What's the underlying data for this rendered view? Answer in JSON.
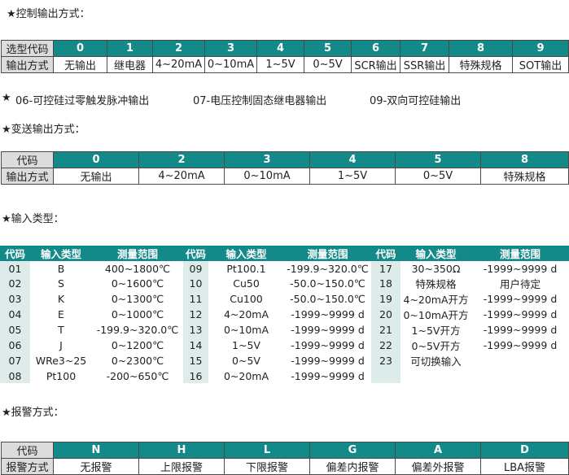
{
  "control_output": {
    "heading": "★控制输出方式：",
    "row1_label": "选型代码",
    "row2_label": "输出方式",
    "codes": [
      "0",
      "1",
      "2",
      "3",
      "4",
      "5",
      "6",
      "7",
      "8",
      "9"
    ],
    "modes": [
      "无输出",
      "继电器",
      "4~20mA",
      "0~10mA",
      "1~5V",
      "0~5V",
      "SCR输出",
      "SSR输出",
      "特殊规格",
      "SOT输出"
    ],
    "note_star": "★",
    "notes": [
      "06-可控硅过零触发脉冲输出",
      "07-电压控制固态继电器输出",
      "09-双向可控硅输出"
    ]
  },
  "transmit_output": {
    "heading": "★变送输出方式：",
    "row1_label": "代码",
    "row2_label": "输出方式",
    "codes": [
      "0",
      "2",
      "3",
      "4",
      "5",
      "8"
    ],
    "modes": [
      "无输出",
      "4~20mA",
      "0~10mA",
      "1~5V",
      "0~5V",
      "特殊规格"
    ]
  },
  "input_type": {
    "heading": "★输入类型：",
    "headers": [
      "代码",
      "输入类型",
      "测量范围",
      "代码",
      "输入类型",
      "测量范围",
      "代码",
      "输入类型",
      "测量范围"
    ],
    "rows": [
      [
        "01",
        "B",
        "400~1800℃",
        "09",
        "Pt100.1",
        "-199.9~320.0℃",
        "17",
        "30~350Ω",
        "-1999~9999 d"
      ],
      [
        "02",
        "S",
        "0~1600℃",
        "10",
        "Cu50",
        "-50.0~150.0℃",
        "18",
        "特殊规格",
        "用户待定"
      ],
      [
        "03",
        "K",
        "0~1300℃",
        "11",
        "Cu100",
        "-50.0~150.0℃",
        "19",
        "4~20mA开方",
        "-1999~9999 d"
      ],
      [
        "04",
        "E",
        "0~1000℃",
        "12",
        "4~20mA",
        "-1999~9999 d",
        "20",
        "0~10mA开方",
        "-1999~9999 d"
      ],
      [
        "05",
        "T",
        "-199.9~320.0℃",
        "13",
        "0~10mA",
        "-1999~9999 d",
        "21",
        "1~5V开方",
        "-1999~9999 d"
      ],
      [
        "06",
        "J",
        "0~1200℃",
        "14",
        "1~5V",
        "-1999~9999 d",
        "22",
        "0~5V开方",
        "-1999~9999 d"
      ],
      [
        "07",
        "WRe3~25",
        "0~2300℃",
        "15",
        "0~5V",
        "-1999~9999 d",
        "23",
        "可切换输入",
        ""
      ],
      [
        "08",
        "Pt100",
        "-200~650℃",
        "16",
        "0~20mA",
        "-1999~9999 d",
        "",
        "",
        ""
      ]
    ]
  },
  "alarm": {
    "heading": "★报警方式：",
    "row1_label": "代码",
    "row2_label": "报警方式",
    "codes": [
      "N",
      "H",
      "L",
      "G",
      "A",
      "D"
    ],
    "modes": [
      "无报警",
      "上限报警",
      "下限报警",
      "偏差内报警",
      "偏差外报警",
      "LBA报警"
    ]
  }
}
